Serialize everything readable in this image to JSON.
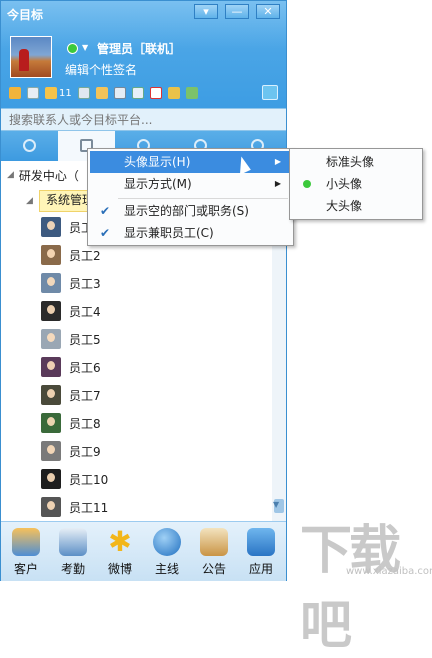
{
  "window": {
    "title": "今目标"
  },
  "profile": {
    "name": "管理员［联机］",
    "signature": "编辑个性签名",
    "notification_count": "11"
  },
  "search": {
    "placeholder": "搜索联系人或今目标平台..."
  },
  "tree": {
    "department": "研发中心（",
    "group": "系统管理",
    "employees": [
      "员工1",
      "员工2",
      "员工3",
      "员工4",
      "员工5",
      "员工6",
      "员工7",
      "员工8",
      "员工9",
      "员工10",
      "员工11"
    ]
  },
  "context_menu": {
    "items": [
      {
        "label": "头像显示(H)",
        "has_submenu": true,
        "highlighted": true
      },
      {
        "label": "显示方式(M)",
        "has_submenu": true
      },
      {
        "label": "显示空的部门或职务(S)",
        "checked": true
      },
      {
        "label": "显示兼职员工(C)",
        "checked": true
      }
    ]
  },
  "submenu": {
    "items": [
      "标准头像",
      "小头像",
      "大头像"
    ],
    "selected": "小头像"
  },
  "bottom_bar": [
    "客户",
    "考勤",
    "微博",
    "主线",
    "公告",
    "应用"
  ],
  "colors": {
    "accent": "#3d9de3",
    "highlight": "#3b8ce0",
    "selected_dot": "#3cc93c"
  },
  "watermark": {
    "text": "下载吧",
    "url_text": "www.xiazaiba.com"
  }
}
